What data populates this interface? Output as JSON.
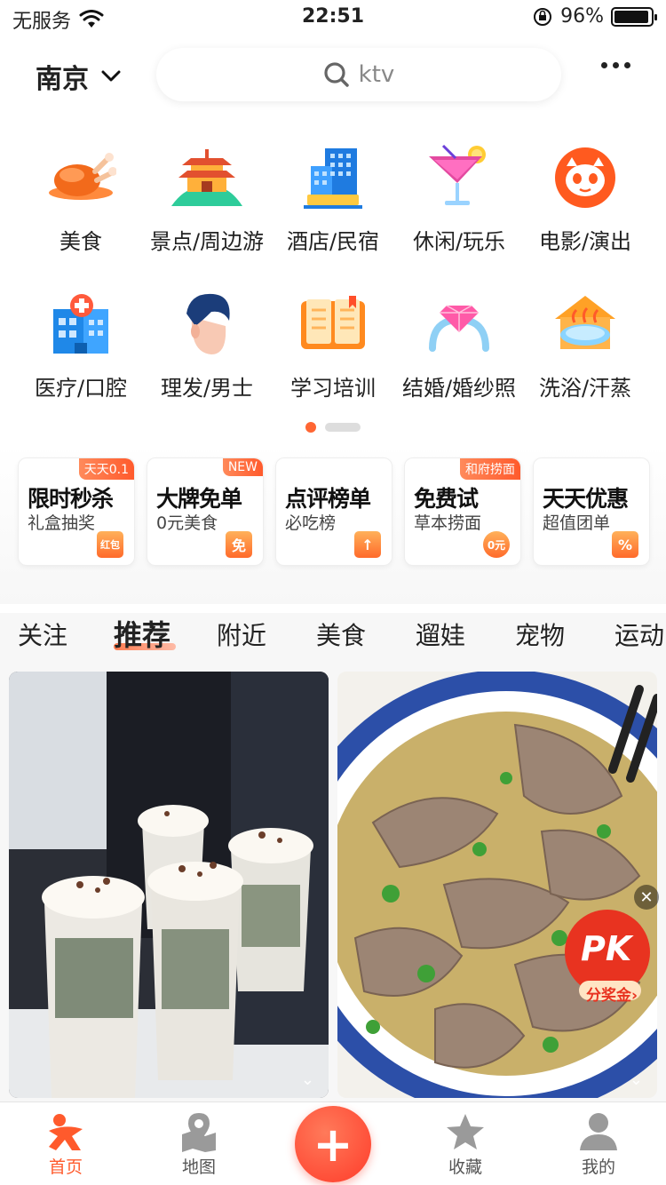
{
  "status": {
    "carrier": "无服务",
    "time": "22:51",
    "battery": "96%",
    "battery_level": 0.96
  },
  "header": {
    "city": "南京",
    "search_placeholder": "ktv"
  },
  "categories": [
    {
      "label": "美食",
      "icon": "roast-chicken-icon"
    },
    {
      "label": "景点/周边游",
      "icon": "pagoda-icon"
    },
    {
      "label": "酒店/民宿",
      "icon": "hotel-building-icon"
    },
    {
      "label": "休闲/玩乐",
      "icon": "cocktail-icon"
    },
    {
      "label": "电影/演出",
      "icon": "cat-face-icon"
    },
    {
      "label": "医疗/口腔",
      "icon": "hospital-icon"
    },
    {
      "label": "理发/男士",
      "icon": "hair-head-icon"
    },
    {
      "label": "学习培训",
      "icon": "book-icon"
    },
    {
      "label": "结婚/婚纱照",
      "icon": "diamond-ring-icon"
    },
    {
      "label": "洗浴/汗蒸",
      "icon": "bath-tub-icon"
    }
  ],
  "promos": [
    {
      "tag": "天天0.1",
      "title": "限时秒杀",
      "sub": "礼盒抽奖",
      "badge": "红包"
    },
    {
      "tag": "NEW",
      "title": "大牌免单",
      "sub": "0元美食",
      "badge": "免"
    },
    {
      "tag": "",
      "title": "点评榜单",
      "sub": "必吃榜",
      "badge": "↑"
    },
    {
      "tag": "和府捞面",
      "title": "免费试",
      "sub": "草本捞面",
      "badge": "0元"
    },
    {
      "tag": "",
      "title": "天天优惠",
      "sub": "超值团单",
      "badge": "%"
    }
  ],
  "feed_tabs": [
    "关注",
    "推荐",
    "附近",
    "美食",
    "遛娃",
    "宠物",
    "运动"
  ],
  "active_feed_tab": "推荐",
  "pk": {
    "title": "PK",
    "sub": "分奖金"
  },
  "tabbar": {
    "home": "首页",
    "map": "地图",
    "add": "+",
    "favorites": "收藏",
    "mine": "我的"
  },
  "colors": {
    "accent": "#ff5a2c",
    "brand_orange": "#ff6633"
  }
}
